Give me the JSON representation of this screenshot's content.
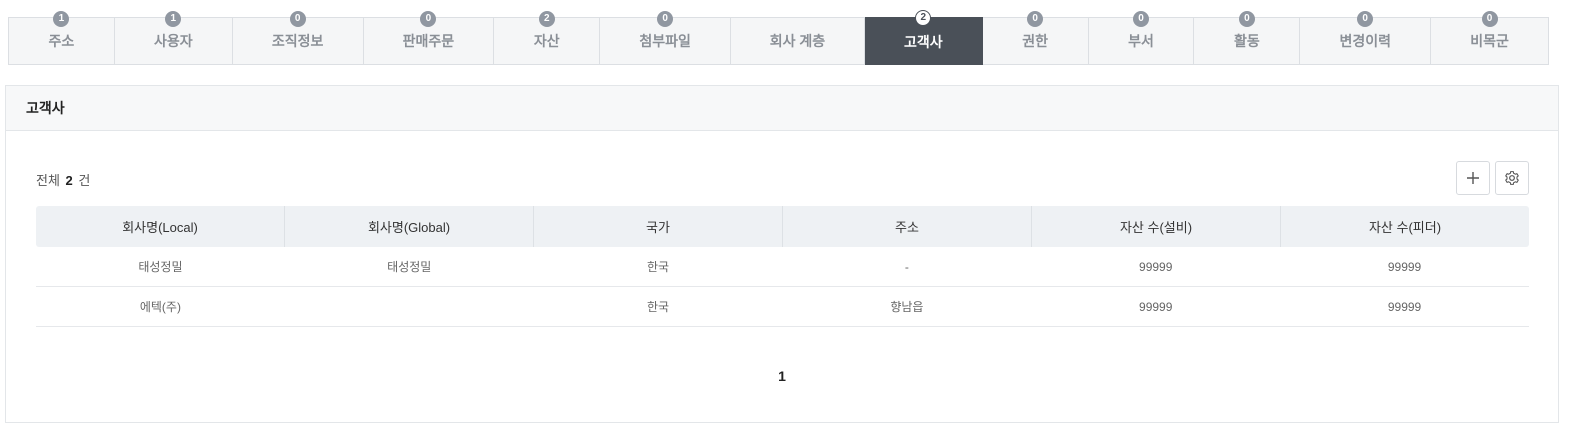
{
  "tabs": [
    {
      "label": "주소",
      "count": "1",
      "width": 106
    },
    {
      "label": "사용자",
      "count": "1",
      "width": 118
    },
    {
      "label": "조직정보",
      "count": "0",
      "width": 131
    },
    {
      "label": "판매주문",
      "count": "0",
      "width": 131
    },
    {
      "label": "자산",
      "count": "2",
      "width": 106
    },
    {
      "label": "첨부파일",
      "count": "0",
      "width": 131
    },
    {
      "label": "회사 계층",
      "count": "",
      "width": 134
    },
    {
      "label": "고객사",
      "count": "2",
      "width": 118,
      "active": true
    },
    {
      "label": "권한",
      "count": "0",
      "width": 106
    },
    {
      "label": "부서",
      "count": "0",
      "width": 106
    },
    {
      "label": "활동",
      "count": "0",
      "width": 106
    },
    {
      "label": "변경이력",
      "count": "0",
      "width": 131
    },
    {
      "label": "비목군",
      "count": "0",
      "width": 117
    }
  ],
  "panel": {
    "title": "고객사",
    "total_prefix": "전체",
    "total_count": "2",
    "total_suffix": "건"
  },
  "icons": {
    "add": "plus-icon",
    "settings": "gear-icon"
  },
  "table": {
    "headers": [
      "회사명(Local)",
      "회사명(Global)",
      "국가",
      "주소",
      "자산 수(설비)",
      "자산 수(피더)"
    ],
    "rows": [
      [
        "태성정밀",
        "태성정밀",
        "한국",
        "-",
        "99999",
        "99999"
      ],
      [
        "에텍(주)",
        "",
        "한국",
        "향남읍",
        "99999",
        "99999"
      ]
    ]
  },
  "pagination": {
    "current": "1"
  },
  "colors": {
    "active_tab": "#4a5058",
    "badge": "#9097a1",
    "header_bg": "#eef1f4"
  }
}
